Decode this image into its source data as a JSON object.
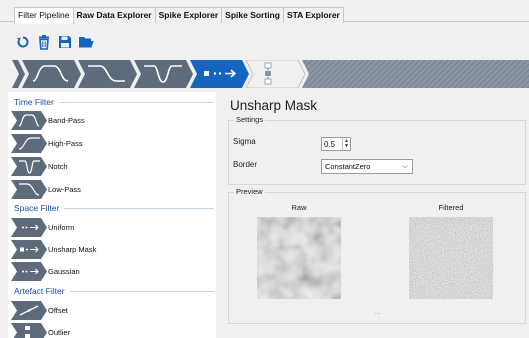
{
  "tabs": [
    {
      "label": "Filter Pipeline",
      "active": true
    },
    {
      "label": "Raw Data Explorer",
      "active": false
    },
    {
      "label": "Spike Explorer",
      "active": false
    },
    {
      "label": "Spike Sorting",
      "active": false
    },
    {
      "label": "STA Explorer",
      "active": false
    }
  ],
  "toolbar": {
    "icons": [
      "refresh-icon",
      "delete-icon",
      "save-icon",
      "open-folder-icon"
    ]
  },
  "colors": {
    "accent": "#1565c0",
    "pipeline_dark": "#5e6b7a",
    "pipeline_stroke": "#ffffff",
    "group_header": "#1f4fa0",
    "hatch": "#7d8896"
  },
  "filter_groups": [
    {
      "header": "Time Filter",
      "items": [
        {
          "label": "Band-Pass",
          "icon": "band-pass-icon"
        },
        {
          "label": "High-Pass",
          "icon": "high-pass-icon"
        },
        {
          "label": "Notch",
          "icon": "notch-icon"
        },
        {
          "label": "Low-Pass",
          "icon": "low-pass-icon"
        }
      ]
    },
    {
      "header": "Space Filter",
      "items": [
        {
          "label": "Uniform",
          "icon": "uniform-icon"
        },
        {
          "label": "Unsharp Mask",
          "icon": "unsharp-mask-icon"
        },
        {
          "label": "Gaussian",
          "icon": "gaussian-icon"
        }
      ]
    },
    {
      "header": "Artefact Filter",
      "items": [
        {
          "label": "Offset",
          "icon": "offset-icon"
        },
        {
          "label": "Outlier",
          "icon": "outlier-icon"
        }
      ]
    }
  ],
  "detail": {
    "title": "Unsharp Mask",
    "settings_label": "Settings",
    "sigma_label": "Sigma",
    "sigma_value": "0.5",
    "border_label": "Border",
    "border_value": "ConstantZero",
    "preview_label": "Preview",
    "raw_label": "Raw",
    "filtered_label": "Filtered",
    "ellipsis": "..."
  }
}
